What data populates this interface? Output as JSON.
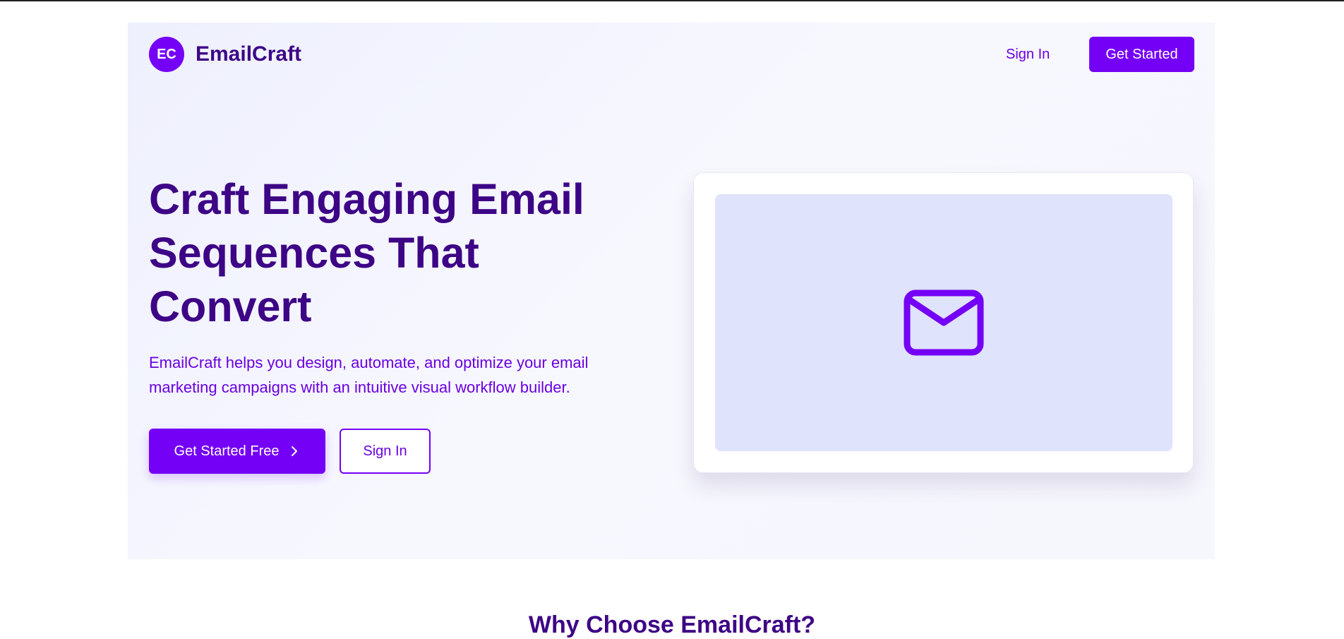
{
  "brand": {
    "badge": "EC",
    "name": "EmailCraft"
  },
  "nav": {
    "signin_label": "Sign In",
    "getstarted_label": "Get Started"
  },
  "hero": {
    "headline_lines": [
      "Craft Engaging Email",
      "Sequences That",
      "Convert"
    ],
    "subtext_lines": [
      "EmailCraft helps you design, automate, and optimize your email",
      "marketing campaigns with an intuitive visual workflow builder."
    ],
    "primary_cta": "Get Started Free",
    "secondary_cta": "Sign In"
  },
  "preview": {
    "icon": "mail-icon"
  },
  "section": {
    "title": "Why Choose EmailCraft?"
  },
  "colors": {
    "accent": "#7400f5",
    "heading": "#3d0586",
    "link": "#6a00e0",
    "preview_bg": "#e0e3fc"
  }
}
